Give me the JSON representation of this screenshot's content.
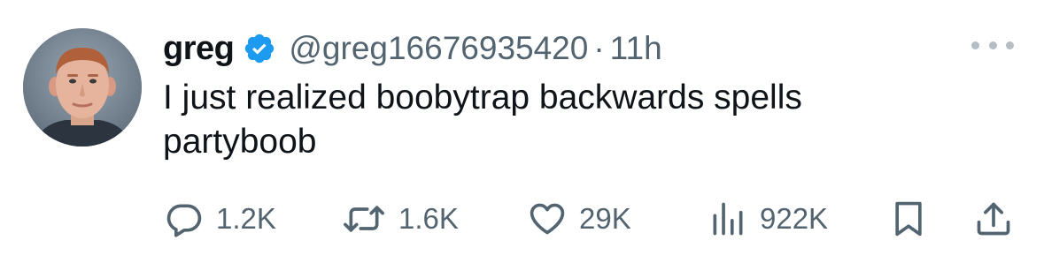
{
  "tweet": {
    "author": {
      "display_name": "greg",
      "handle": "@greg16676935420",
      "verified": true
    },
    "separator": "·",
    "timestamp": "11h",
    "text": "I just realized boobytrap backwards spells partyboob",
    "metrics": {
      "replies": "1.2K",
      "reposts": "1.6K",
      "likes": "29K",
      "views": "922K"
    }
  },
  "colors": {
    "primary_text": "#0f1419",
    "secondary_text": "#536471",
    "verified_badge": "#1d9bf0",
    "background": "#ffffff"
  },
  "icons": {
    "verified": "verified-badge-icon",
    "more": "more-horizontal-icon",
    "reply": "reply-icon",
    "repost": "repost-icon",
    "like": "heart-icon",
    "views": "views-chart-icon",
    "bookmark": "bookmark-icon",
    "share": "share-icon"
  }
}
